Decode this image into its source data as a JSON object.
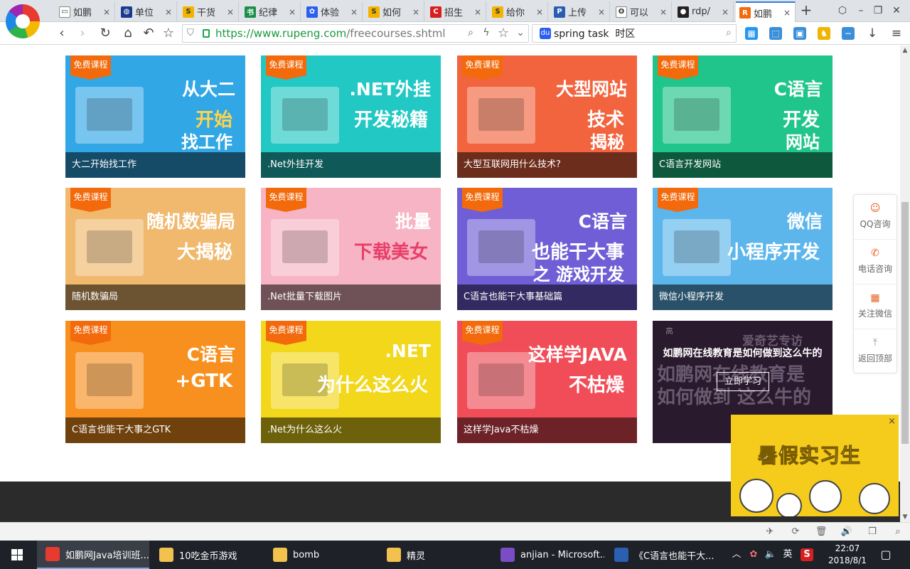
{
  "tabs": [
    {
      "label": "如鹏",
      "icon": "doc-icon",
      "color": "#ffffff",
      "glyph": "▭"
    },
    {
      "label": "单位",
      "icon": "globe-icon",
      "color": "#1a3a8f",
      "glyph": "◍"
    },
    {
      "label": "干货",
      "icon": "s-icon",
      "color": "#f2b400",
      "glyph": "S"
    },
    {
      "label": "纪律",
      "icon": "green-book-icon",
      "color": "#1a8f4a",
      "glyph": "书"
    },
    {
      "label": "体验",
      "icon": "paw-icon",
      "color": "#2b5ff0",
      "glyph": "✿"
    },
    {
      "label": "如何",
      "icon": "s-icon",
      "color": "#f2b400",
      "glyph": "S"
    },
    {
      "label": "招生",
      "icon": "c-icon",
      "color": "#d62020",
      "glyph": "C"
    },
    {
      "label": "给你",
      "icon": "s-icon",
      "color": "#f2b400",
      "glyph": "S"
    },
    {
      "label": "上传",
      "icon": "p-icon",
      "color": "#2a5db0",
      "glyph": "P"
    },
    {
      "label": "可以",
      "icon": "search-icon",
      "color": "#ffffff",
      "glyph": "ʘ"
    },
    {
      "label": "rdp/",
      "icon": "github-icon",
      "color": "#222222",
      "glyph": "●"
    },
    {
      "label": "如鹏",
      "icon": "rupeng-icon",
      "color": "#f26a0b",
      "glyph": "R"
    }
  ],
  "tab_close": "×",
  "new_tab": "+",
  "window": {
    "tiles": "⬡",
    "min": "–",
    "restore": "❐",
    "close": "✕"
  },
  "nav": {
    "back": "‹",
    "forward": "›",
    "reload": "↻",
    "home": "⌂",
    "undo": "↶",
    "star": "☆"
  },
  "address": {
    "protocol": "https://",
    "host": "www.rupeng.com",
    "path": "/freecourses.shtml",
    "zoom": "⌕",
    "bolt": "ϟ",
    "fav": "☆",
    "dd": "⌄"
  },
  "search": {
    "value": "spring task  时区",
    "engine": "du"
  },
  "extensions": [
    {
      "name": "apps-icon",
      "glyph": "▦",
      "color": "#2196f3"
    },
    {
      "name": "screenshot-icon",
      "glyph": "⬚",
      "color": "#3b8fd9"
    },
    {
      "name": "qr-icon",
      "glyph": "▣",
      "color": "#3b8fd9"
    },
    {
      "name": "game-icon",
      "glyph": "♞",
      "color": "#f0b400"
    },
    {
      "name": "minus-icon",
      "glyph": "−",
      "color": "#3b8fd9"
    },
    {
      "name": "download-icon",
      "glyph": "↓",
      "color": "#444444"
    },
    {
      "name": "menu-icon",
      "glyph": "≡",
      "color": "#444444"
    }
  ],
  "courses": [
    {
      "badge": "免费课程",
      "title": "大二开始找工作",
      "bg": "#31a7e6",
      "big1": "从大二",
      "big2": "开始",
      "big3": "找工作",
      "c2": "#ffd54a"
    },
    {
      "badge": "免费课程",
      "title": ".Net外挂开发",
      "bg": "#22c8c4",
      "big1": ".NET外挂",
      "big2": "开发秘籍",
      "big3": "",
      "c2": "#ffffff"
    },
    {
      "badge": "免费课程",
      "title": "大型互联网用什么技术?",
      "bg": "#f2643e",
      "big1": "大型网站",
      "big2": "技术",
      "big3": "揭秘",
      "c2": "#ffffff"
    },
    {
      "badge": "免费课程",
      "title": "C语言开发网站",
      "bg": "#1fc58a",
      "big1": "C语言",
      "big2": "开发",
      "big3": "网站",
      "c2": "#ffffff"
    },
    {
      "badge": "免费课程",
      "title": "随机数骗局",
      "bg": "#f0b96e",
      "big1": "随机数骗局",
      "big2": "大揭秘",
      "big3": "",
      "c2": "#ffffff"
    },
    {
      "badge": "免费课程",
      "title": ".Net批量下载图片",
      "bg": "#f7b4c4",
      "big1": "批量",
      "big2": "下载美女",
      "big3": "",
      "c2": "#e83e6a"
    },
    {
      "badge": "免费课程",
      "title": "C语言也能干大事基础篇",
      "bg": "#6f5ed6",
      "big1": "C语言",
      "big2": "也能干大事",
      "big3": "之 游戏开发",
      "c2": "#ffffff"
    },
    {
      "badge": "免费课程",
      "title": "微信小程序开发",
      "bg": "#5cb6ec",
      "big1": "微信",
      "big2": "小程序开发",
      "big3": "",
      "c2": "#ffffff"
    },
    {
      "badge": "免费课程",
      "title": "C语言也能干大事之GTK",
      "bg": "#f7901e",
      "big1": "C语言",
      "big2": "+GTK",
      "big3": "",
      "c2": "#ffffff"
    },
    {
      "badge": "免费课程",
      "title": ".Net为什么这么火",
      "bg": "#f2d71a",
      "big1": ".NET",
      "big2": "为什么这么火",
      "big3": "",
      "c2": "#ffffff"
    },
    {
      "badge": "免费课程",
      "title": "这样学Java不枯燥",
      "bg": "#f04d58",
      "big1": "这样学JAVA",
      "big2": "不枯燥",
      "big3": "",
      "c2": "#ffffff"
    }
  ],
  "promo": {
    "brand": "爱奇艺专访",
    "badge": "高",
    "bgtext1": "如鹏网在线教育是",
    "bgtext2": "如何做到 这么牛的",
    "title": "如鹏网在线教育是如何做到这么牛的",
    "button": "立即学习"
  },
  "sidebar": [
    {
      "label": "QQ咨询",
      "icon": "qq-chat-icon",
      "glyph": "☺"
    },
    {
      "label": "电话咨询",
      "icon": "phone-icon",
      "glyph": "✆"
    },
    {
      "label": "关注微信",
      "icon": "wechat-qr-icon",
      "glyph": "▦"
    },
    {
      "label": "返回顶部",
      "icon": "back-to-top-icon",
      "glyph": "⤒"
    }
  ],
  "intern": {
    "title": "暑假实习生",
    "close": "×"
  },
  "scroll": {
    "up": "▲",
    "down": "▼"
  },
  "status_icons": [
    "✈",
    "⟳",
    "🗑",
    "🔊",
    "❐",
    "⌕"
  ],
  "taskbar": [
    {
      "label": "如鹏网Java培训班...",
      "color": "#e63b2e",
      "active": true
    },
    {
      "label": "10吃金币游戏",
      "color": "#f2c14e",
      "active": false
    },
    {
      "label": "bomb",
      "color": "#f2c14e",
      "active": false
    },
    {
      "label": "精灵",
      "color": "#f2c14e",
      "active": false
    },
    {
      "label": "anjian - Microsoft...",
      "color": "#7a4cc6",
      "active": false
    },
    {
      "label": "《C语言也能干大...",
      "color": "#2b5fb0",
      "active": false
    }
  ],
  "tray": {
    "up": "︿",
    "flower": "✿",
    "vol": "🔈",
    "ime": "英",
    "s": "S",
    "notif": "▢"
  },
  "clock": {
    "time": "22:07",
    "date": "2018/8/1"
  }
}
